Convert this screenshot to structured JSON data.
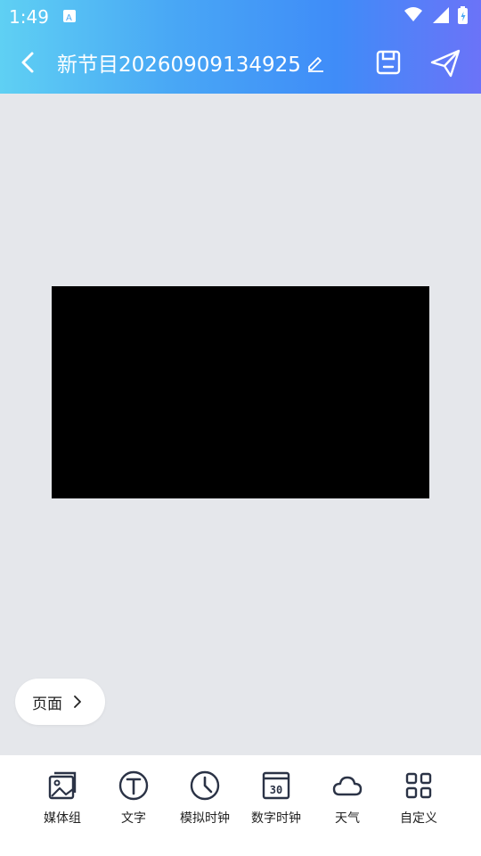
{
  "status_bar": {
    "time": "1:49"
  },
  "app_bar": {
    "title": "新节目20260909134925"
  },
  "canvas": {
    "screen_color": "#000000"
  },
  "page_button": {
    "label": "页面"
  },
  "toolbar": {
    "items": [
      {
        "label": "媒体组",
        "icon": "image-gallery-icon"
      },
      {
        "label": "文字",
        "icon": "text-icon"
      },
      {
        "label": "模拟时钟",
        "icon": "analog-clock-icon"
      },
      {
        "label": "数字时钟",
        "icon": "digital-clock-icon"
      },
      {
        "label": "天气",
        "icon": "weather-cloud-icon"
      },
      {
        "label": "自定义",
        "icon": "grid-icon"
      }
    ]
  },
  "colors": {
    "header_gradient_start": "#5fd0f3",
    "header_gradient_end": "#6b73f8",
    "canvas_background": "#e5e7eb",
    "icon_dark": "#2b3346"
  }
}
